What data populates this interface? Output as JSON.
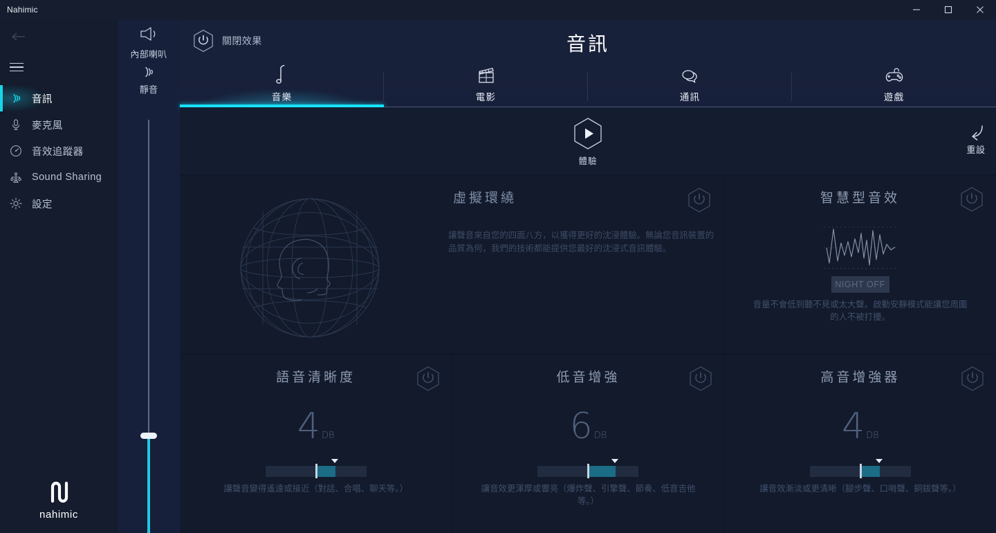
{
  "window": {
    "title": "Nahimic",
    "controls": [
      {
        "name": "minimize",
        "glyph": "minimize-icon"
      },
      {
        "name": "maximize",
        "glyph": "maximize-icon"
      },
      {
        "name": "close",
        "glyph": "close-icon"
      }
    ]
  },
  "colors": {
    "accent": "#16e2fb",
    "accent_dim": "#19d4e8",
    "slider_fill": "#1a6d85",
    "bg": "#121a2b",
    "panel": "#18213a",
    "sidebar": "#141c2d",
    "volume_col": "#16203a",
    "text_muted": "#41506c"
  },
  "sidebar": {
    "back_icon": "back-arrow-icon",
    "menu_icon": "hamburger-icon",
    "items": [
      {
        "label": "音訊",
        "icon": "audio-waves-icon",
        "active": true
      },
      {
        "label": "麥克風",
        "icon": "microphone-icon",
        "active": false
      },
      {
        "label": "音效追蹤器",
        "icon": "sound-tracker-icon",
        "active": false
      },
      {
        "label": "Sound Sharing",
        "icon": "sound-sharing-icon",
        "active": false
      },
      {
        "label": "設定",
        "icon": "gear-icon",
        "active": false
      }
    ],
    "brand": "nahimic"
  },
  "volume": {
    "device_icon": "speaker-icon",
    "device_label": "內部喇叭",
    "mute_icon": "mute-waves-icon",
    "mute_label": "靜音"
  },
  "header": {
    "power_icon": "power-hexagon-icon",
    "off_effects_label": "關閉效果",
    "page_title": "音訊"
  },
  "tabs": [
    {
      "label": "音樂",
      "icon": "music-note-icon",
      "active": true
    },
    {
      "label": "電影",
      "icon": "clapperboard-icon",
      "active": false
    },
    {
      "label": "通訊",
      "icon": "speech-bubbles-icon",
      "active": false
    },
    {
      "label": "遊戲",
      "icon": "gamepad-icon",
      "active": false
    }
  ],
  "demo": {
    "play_icon": "play-hexagon-icon",
    "label": "體驗",
    "reset_icon": "reset-arrow-icon",
    "reset_label": "重設"
  },
  "features": {
    "virtual_surround": {
      "title": "虛擬環繞",
      "power_icon": "power-hexagon-icon",
      "description": "讓聲音來自您的四面八方，以獲得更好的沈浸體驗。無論您音訊裝置的品質為何，我們的技術都能提供您最好的沈浸式音訊體驗。",
      "graphic": "head-in-sphere-icon"
    },
    "smart_audio": {
      "title": "智慧型音效",
      "power_icon": "power-hexagon-icon",
      "graphic": "waveform-icon",
      "night_button": "NIGHT OFF",
      "description": "音量不會低到聽不見或太大聲。啟動安靜模式能讓您周圍的人不被打擾。"
    },
    "voice_clarity": {
      "title": "語音清晰度",
      "power_icon": "power-hexagon-icon",
      "value": "4",
      "unit": "DB",
      "description": "讓聲音變得遙遠或接近（對話、合唱、聊天等。）",
      "slider": {
        "min": -12,
        "max": 12,
        "value": 4
      }
    },
    "bass_boost": {
      "title": "低音增強",
      "power_icon": "power-hexagon-icon",
      "value": "6",
      "unit": "DB",
      "description": "讓音效更渾厚或響亮（爆炸聲、引擎聲、節奏、低音吉他等。）",
      "slider": {
        "min": -12,
        "max": 12,
        "value": 6
      }
    },
    "treble_boost": {
      "title": "高音增強器",
      "power_icon": "power-hexagon-icon",
      "value": "4",
      "unit": "DB",
      "description": "讓音效漸淡或更清晰（腳步聲、口哨聲、銅鈸聲等。）",
      "slider": {
        "min": -12,
        "max": 12,
        "value": 4
      }
    }
  }
}
